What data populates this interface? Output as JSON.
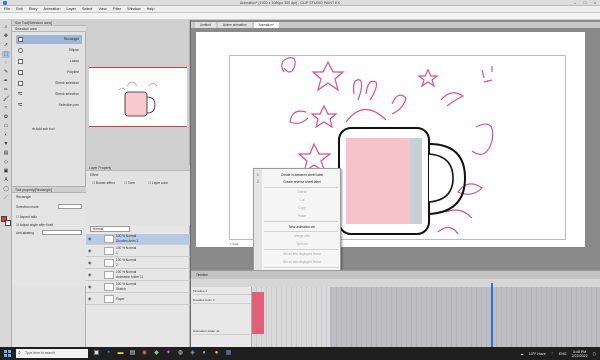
{
  "titlebar": {
    "title": "Animation* (1920 x 1080px 300 dpi) - CLIP STUDIO PAINT EX"
  },
  "menubar": {
    "items": [
      "File",
      "Edit",
      "Story",
      "Animation",
      "Layer",
      "Select",
      "View",
      "Filter",
      "Window",
      "Help"
    ]
  },
  "window_controls": [
    "–",
    "□",
    "×"
  ],
  "subtool_panel": {
    "header": "Sub Tool[Selection area]",
    "tool_header": "Selection area",
    "items": [
      "Rectangle",
      "Ellipse",
      "Lasso",
      "Polyline",
      "Shrink selection",
      "Shrink selection",
      "Selection pen"
    ],
    "add_label": "Add sub tool"
  },
  "tool_property": {
    "header": "Tool property[Rectangle]",
    "tool_name": "Rectangle",
    "rows": [
      "Selection mode",
      "Aspect ratio",
      "Adjust angle after fixed",
      "Anti-aliasing"
    ]
  },
  "layer_property": {
    "header": "Layer Property",
    "effect_label": "Effect",
    "options": [
      "Border effect",
      "Tone",
      "Layer color"
    ]
  },
  "layer_panel": {
    "blend_mode": "Normal",
    "layers": [
      {
        "name": "100 % Normal",
        "sub": "Doodles Anim 2"
      },
      {
        "name": "100 % Normal",
        "sub": "1"
      },
      {
        "name": "100 % Normal",
        "sub": "2"
      },
      {
        "name": "100 % Normal",
        "sub": "Animation folder 11"
      },
      {
        "name": "100 % Normal",
        "sub": "Sketch"
      },
      {
        "name": "Paper",
        "sub": ""
      }
    ]
  },
  "canvas": {
    "tabs": [
      "Untitled",
      "Anime animation",
      "Animation*"
    ],
    "active_tab": "Animation*",
    "frame_label": "1 data"
  },
  "context_menu": {
    "items": [
      {
        "num": "1",
        "label": "Create in-between sheet label",
        "enabled": true
      },
      {
        "num": "2",
        "label": "Create reverse sheet label",
        "enabled": true
      },
      {
        "num": "",
        "label": "Delete",
        "enabled": false
      },
      {
        "num": "",
        "label": "Cut",
        "enabled": false
      },
      {
        "num": "",
        "label": "Copy",
        "enabled": false
      },
      {
        "num": "",
        "label": "Paste",
        "enabled": false
      },
      {
        "num": "",
        "label": "New animation cel",
        "enabled": true
      },
      {
        "num": "",
        "label": "Merge cels",
        "enabled": false
      },
      {
        "num": "",
        "label": "Split cel",
        "enabled": false
      },
      {
        "num": "",
        "label": "Set as first displayed frame",
        "enabled": false
      },
      {
        "num": "",
        "label": "Set as last displayed frame",
        "enabled": false
      },
      {
        "num": "",
        "label": "Insert frame",
        "enabled": true
      },
      {
        "num": "",
        "label": "Delete frame",
        "enabled": true
      }
    ],
    "input_value": "1"
  },
  "timeline": {
    "header": "Timeline",
    "tracks": [
      "Timeline 1",
      "Doodles Anim 2",
      "Animation folder 11"
    ]
  },
  "taskbar": {
    "search_placeholder": "Type here to search",
    "weather": "10°F Haze",
    "language": "ENG",
    "time": "3:45 PM",
    "date": "2/22/2022"
  }
}
